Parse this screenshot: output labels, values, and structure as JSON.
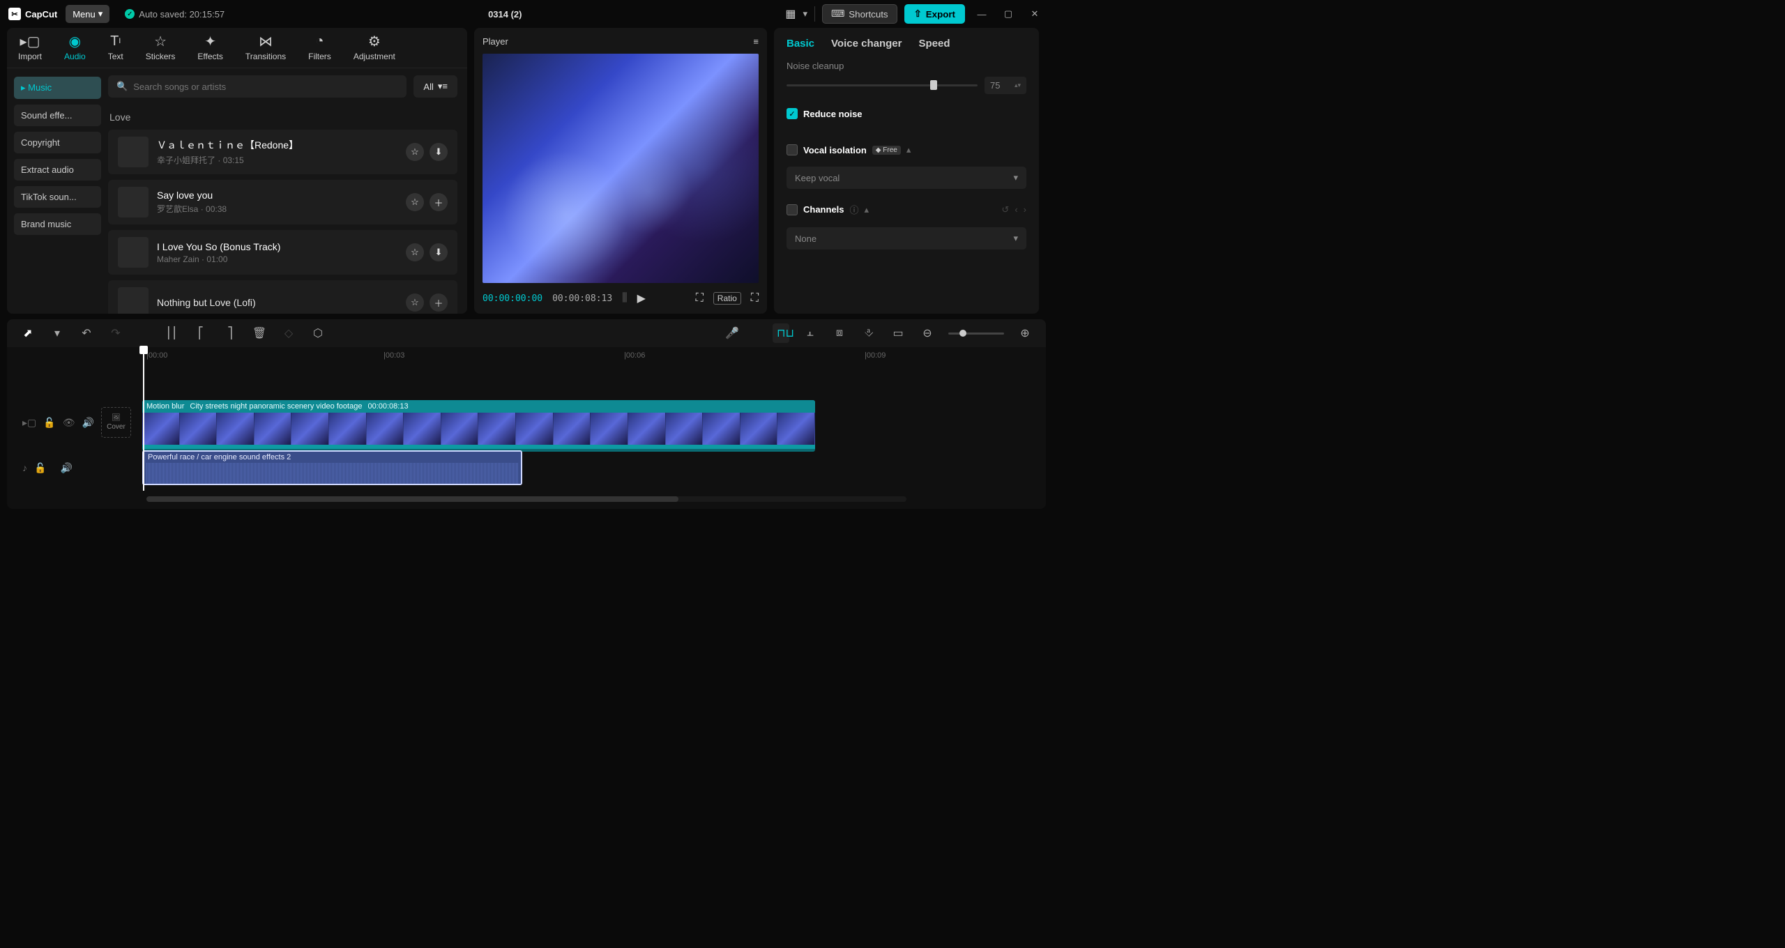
{
  "app": {
    "name": "CapCut"
  },
  "titlebar": {
    "menu": "Menu",
    "autosaved_prefix": "Auto saved: ",
    "autosaved_time": "20:15:57",
    "project": "0314 (2)",
    "shortcuts": "Shortcuts",
    "export": "Export"
  },
  "top_tabs": [
    {
      "id": "import",
      "label": "Import"
    },
    {
      "id": "audio",
      "label": "Audio",
      "active": true
    },
    {
      "id": "text",
      "label": "Text"
    },
    {
      "id": "stickers",
      "label": "Stickers"
    },
    {
      "id": "effects",
      "label": "Effects"
    },
    {
      "id": "transitions",
      "label": "Transitions"
    },
    {
      "id": "filters",
      "label": "Filters"
    },
    {
      "id": "adjustment",
      "label": "Adjustment"
    }
  ],
  "sidebar": {
    "items": [
      {
        "label": "Music",
        "active": true
      },
      {
        "label": "Sound effe..."
      },
      {
        "label": "Copyright"
      },
      {
        "label": "Extract audio"
      },
      {
        "label": "TikTok soun..."
      },
      {
        "label": "Brand music"
      }
    ]
  },
  "search": {
    "placeholder": "Search songs or artists",
    "all": "All"
  },
  "category": "Love",
  "tracks": [
    {
      "title": "Ｖａｌｅｎｔｉｎｅ【Redone】",
      "artist": "幸子小姐拜托了",
      "dur": "03:15",
      "act2": "dl"
    },
    {
      "title": "Say love you",
      "artist": "罗艺歆Elsa",
      "dur": "00:38",
      "act2": "plus"
    },
    {
      "title": "I Love You So (Bonus Track)",
      "artist": "Maher Zain",
      "dur": "01:00",
      "act2": "dl"
    },
    {
      "title": "Nothing but Love (Lofi)",
      "artist": "",
      "dur": "",
      "act2": "plus"
    }
  ],
  "player": {
    "title": "Player",
    "current": "00:00:00:00",
    "total": "00:00:08:13",
    "ratio": "Ratio"
  },
  "inspector": {
    "tabs": [
      {
        "label": "Basic",
        "active": true
      },
      {
        "label": "Voice changer"
      },
      {
        "label": "Speed"
      }
    ],
    "noise_cleanup": "Noise cleanup",
    "noise_value": "75",
    "reduce_noise": "Reduce noise",
    "vocal_isolation": "Vocal isolation",
    "free_badge": "Free",
    "keep_vocal": "Keep vocal",
    "channels": "Channels",
    "none": "None"
  },
  "timeline": {
    "ticks": [
      "|00:00",
      "|00:03",
      "|00:06",
      "|00:09"
    ],
    "cover": "Cover",
    "video_clip": {
      "badge": "Motion blur",
      "name": "City streets night panoramic scenery video footage",
      "dur": "00:00:08:13"
    },
    "audio_clip": {
      "name": "Powerful race / car engine sound effects 2"
    }
  }
}
